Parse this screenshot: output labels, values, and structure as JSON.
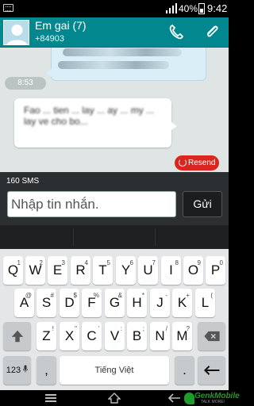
{
  "status_bar": {
    "keyboard_icon": "keyboard-icon",
    "signal_icon": "signal-icon",
    "battery_percent": "40%",
    "battery_icon": "battery-icon",
    "time": "9:42"
  },
  "header": {
    "contact_name": "Em gai (7)",
    "phone_number": "+84903",
    "call_icon": "phone-icon",
    "attach_icon": "paperclip-icon",
    "color": "#02878f"
  },
  "conversation": {
    "timestamp": "8:53",
    "outgoing_message": "Fao ... tien ... lay ... ay ... my ... lay ve cho bo...",
    "resend_label": "Resend",
    "resend_color": "#d9261e"
  },
  "composer": {
    "char_count": "160",
    "char_count_label": "SMS",
    "input_placeholder": "Nhập tin nhắn.",
    "send_label": "Gửi"
  },
  "keyboard": {
    "row1": [
      {
        "key": "Q",
        "hint": "1"
      },
      {
        "key": "W",
        "hint": "2"
      },
      {
        "key": "E",
        "hint": "3"
      },
      {
        "key": "R",
        "hint": "4"
      },
      {
        "key": "T",
        "hint": "5"
      },
      {
        "key": "Y",
        "hint": "6"
      },
      {
        "key": "U",
        "hint": "7"
      },
      {
        "key": "I",
        "hint": "8"
      },
      {
        "key": "O",
        "hint": "9"
      },
      {
        "key": "P",
        "hint": "0"
      }
    ],
    "row2": [
      {
        "key": "A",
        "hint": "@"
      },
      {
        "key": "S",
        "hint": "#"
      },
      {
        "key": "D",
        "hint": "$"
      },
      {
        "key": "F",
        "hint": "%"
      },
      {
        "key": "G",
        "hint": "&"
      },
      {
        "key": "H",
        "hint": "*"
      },
      {
        "key": "J",
        "hint": "-"
      },
      {
        "key": "K",
        "hint": "+"
      },
      {
        "key": "L",
        "hint": "("
      }
    ],
    "row3": [
      {
        "key": "Z",
        "hint": "!"
      },
      {
        "key": "X",
        "hint": "\""
      },
      {
        "key": "C",
        "hint": "'"
      },
      {
        "key": "V",
        "hint": ":"
      },
      {
        "key": "B",
        "hint": ";"
      },
      {
        "key": "N",
        "hint": "/"
      },
      {
        "key": "M",
        "hint": "?"
      }
    ],
    "shift_icon": "shift-icon",
    "backspace_icon": "backspace-icon",
    "symbols_label": "123",
    "mic_icon": "microphone-icon",
    "comma": ",",
    "space_label": "Tiếng Việt",
    "period": ".",
    "enter_icon": "enter-icon"
  },
  "nav_bar": {
    "menu_icon": "menu-icon",
    "home_icon": "home-icon",
    "back_icon": "back-icon"
  },
  "watermark": {
    "brand": "GenkMobile",
    "tagline": "TALK MORE!"
  }
}
